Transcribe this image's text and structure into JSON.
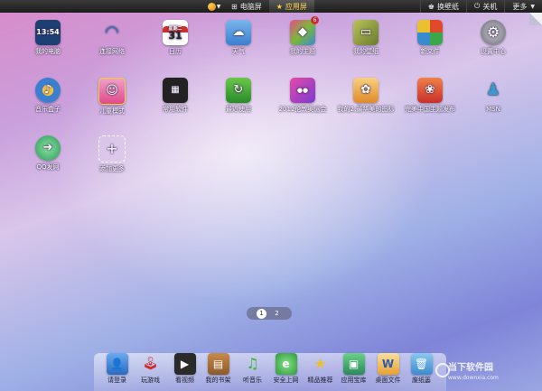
{
  "topbar": {
    "tabs": [
      {
        "label": "电脑屏",
        "icon": "windows-icon"
      },
      {
        "label": "应用屏",
        "icon": "star-icon"
      }
    ],
    "wallpaper_label": "换壁纸",
    "shutdown_label": "关机",
    "more_label": "更多"
  },
  "clock_display": "13:54",
  "calendar": {
    "weekday": "星期二",
    "day": "31"
  },
  "apps": [
    {
      "label": "我的电脑",
      "icon": "computer-icon",
      "color": "#2d6fb8"
    },
    {
      "label": "连接网络",
      "icon": "wifi-icon",
      "color": "#1f7fd6"
    },
    {
      "label": "日历",
      "icon": "calendar-icon",
      "color": "#ffffff"
    },
    {
      "label": "天气",
      "icon": "weather-icon",
      "color": "#5aa0e0"
    },
    {
      "label": "我的主题",
      "icon": "theme-icon",
      "color": "#7cb83a",
      "badge": "6"
    },
    {
      "label": "我的壁纸",
      "icon": "wallpaper-icon",
      "color": "#8a8f3a"
    },
    {
      "label": "新文件",
      "icon": "newfile-icon",
      "color": "#e04a2a"
    },
    {
      "label": "设置中心",
      "icon": "gear-icon",
      "color": "#8a8a94"
    },
    {
      "label": "音乐盒子",
      "icon": "music-box-icon",
      "color": "#3a7fd0"
    },
    {
      "label": "儿童模式",
      "icon": "kid-mode-icon",
      "color": "#e06aa0"
    },
    {
      "label": "常用软件",
      "icon": "software-icon",
      "color": "#2a2a2a"
    },
    {
      "label": "最近使用",
      "icon": "recent-icon",
      "color": "#3a9a3a"
    },
    {
      "label": "2012伦敦奥运会",
      "icon": "london-icon",
      "color": "#c83aa8"
    },
    {
      "label": "我的2,最华美的图标",
      "icon": "game-icon",
      "color": "#e8a030"
    },
    {
      "label": "完美中国主题发布",
      "icon": "theme-china-icon",
      "color": "#d04a2a"
    },
    {
      "label": "MSN",
      "icon": "msn-icon",
      "color": "#3a9ad0"
    },
    {
      "label": "QQ发网",
      "icon": "qq-arrow-icon",
      "color": "#3aa86a"
    },
    {
      "label": "添加更多",
      "icon": "add-more-icon",
      "color": "#c8a8d8"
    }
  ],
  "pager": {
    "pages": [
      "1",
      "2"
    ],
    "current": "1"
  },
  "dock": [
    {
      "label": "请登录",
      "icon": "user-icon",
      "color": "#3a7ad0"
    },
    {
      "label": "玩游戏",
      "icon": "joystick-icon",
      "color": "#8a8a94"
    },
    {
      "label": "看视频",
      "icon": "video-icon",
      "color": "#2a2a2a"
    },
    {
      "label": "我的书架",
      "icon": "bookshelf-icon",
      "color": "#a86a2a"
    },
    {
      "label": "听音乐",
      "icon": "music-icon",
      "color": "#4ab83a"
    },
    {
      "label": "安全上网",
      "icon": "ie-icon",
      "color": "#2a8ad0"
    },
    {
      "label": "精品推荐",
      "icon": "recommend-icon",
      "color": "#e8c030"
    },
    {
      "label": "应用宝库",
      "icon": "app-store-icon",
      "color": "#3ab86a"
    },
    {
      "label": "桌面文件",
      "icon": "desktop-file-icon",
      "color": "#e8a030"
    },
    {
      "label": "废纸篓",
      "icon": "trash-icon",
      "color": "#4a9ad0"
    }
  ],
  "watermark": {
    "title": "当下软件园",
    "sub": "www.downxia.com"
  }
}
